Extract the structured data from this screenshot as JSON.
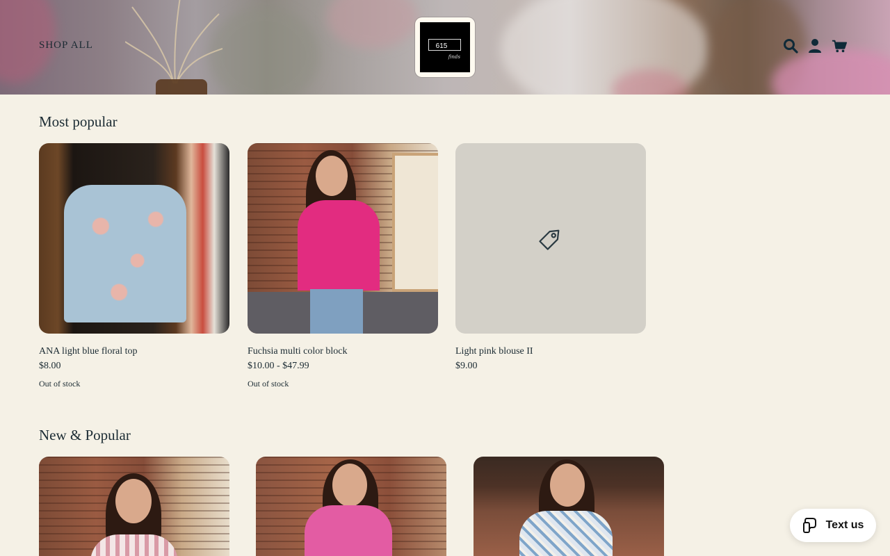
{
  "header": {
    "nav_link": "SHOP ALL",
    "logo_text": "615",
    "logo_script": "finds",
    "icons": [
      "search-icon",
      "account-icon",
      "cart-icon"
    ]
  },
  "sections": [
    {
      "title": "Most popular",
      "products": [
        {
          "name": "ANA light blue floral top",
          "price": "$8.00",
          "stock": "Out of stock",
          "image": "floral-top-on-hanger"
        },
        {
          "name": "Fuchsia multi color block",
          "price": "$10.00 - $47.99",
          "stock": "Out of stock",
          "image": "model-fuchsia-pullover"
        },
        {
          "name": "Light pink blouse II",
          "price": "$9.00",
          "stock": "",
          "image": "placeholder-tag-icon"
        }
      ]
    },
    {
      "title": "New & Popular",
      "products": [
        {
          "image": "model-striped-top"
        },
        {
          "image": "model-pink-ruffle-top"
        },
        {
          "image": "model-floral-dress"
        }
      ]
    }
  ],
  "chat_widget": {
    "label": "Text us",
    "icon": "chat-phone-icon"
  },
  "colors": {
    "background": "#f5f1e6",
    "text": "#1b2b33",
    "placeholder": "#d3d0c8"
  }
}
